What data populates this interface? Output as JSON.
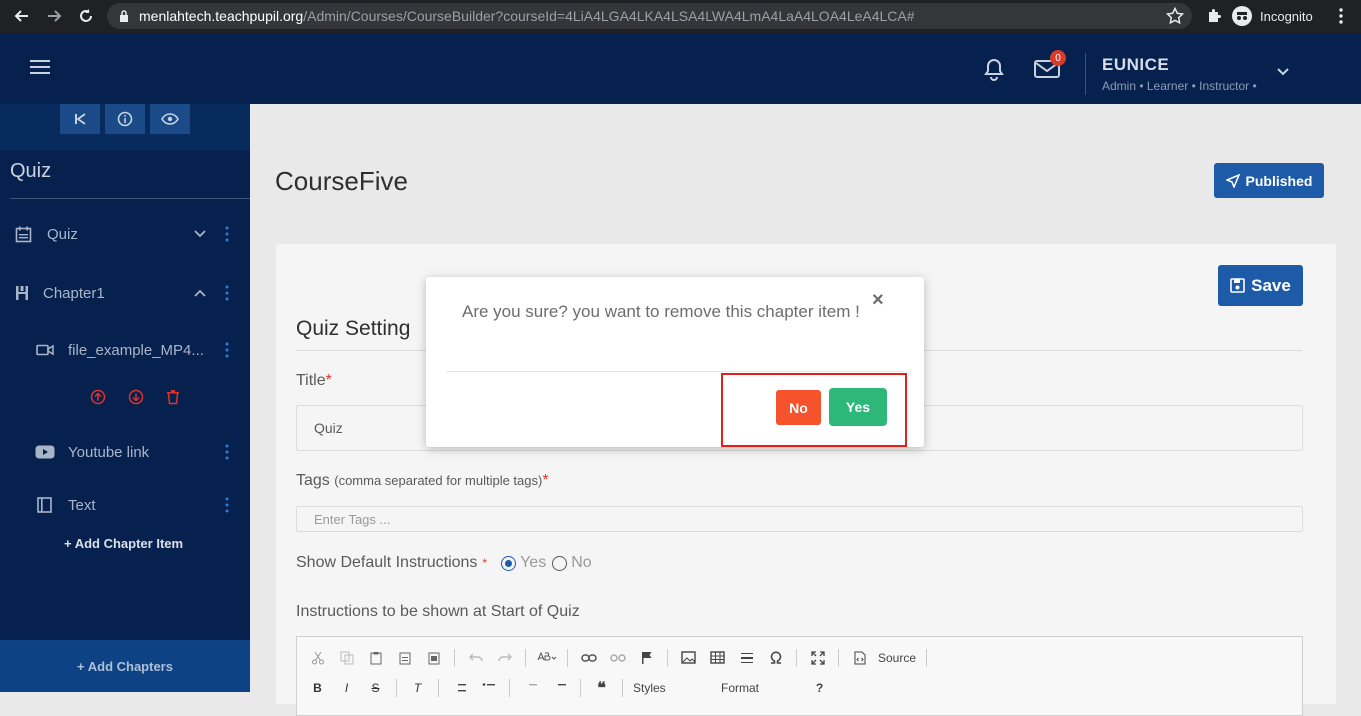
{
  "browser": {
    "url_host": "menlahtech.teachpupil.org",
    "url_path": "/Admin/Courses/CourseBuilder?courseId=4LiA4LGA4LKA4LSA4LWA4LmA4LaA4LOA4LeA4LCA#",
    "incognito_label": "Incognito"
  },
  "header": {
    "mail_badge": "0",
    "user_name": "EUNICE",
    "user_roles": "Admin • Learner • Instructor •"
  },
  "sidebar": {
    "title": "Quiz",
    "items": [
      {
        "label": "Quiz"
      },
      {
        "label": "Chapter1"
      },
      {
        "label": "file_example_MP4..."
      },
      {
        "label": "Youtube link"
      },
      {
        "label": "Text"
      }
    ],
    "add_item_label": "+ Add Chapter Item",
    "add_chapters_label": "+  Add Chapters"
  },
  "main": {
    "course_title": "CourseFive",
    "published_label": "Published",
    "save_label": "Save",
    "section_title": "Quiz Setting",
    "title_label": "Title",
    "title_value": "Quiz",
    "tags_label": "Tags",
    "tags_hint": "(comma separated for multiple tags)",
    "tags_placeholder": "Enter Tags ...",
    "instructions_label": "Show Default Instructions",
    "radio_yes": "Yes",
    "radio_no": "No",
    "start_instructions_label": "Instructions to be shown at Start of Quiz",
    "editor_source_label": "Source",
    "editor_styles_label": "Styles",
    "editor_format_label": "Format",
    "required_mark": "*"
  },
  "modal": {
    "message": "Are you sure? you want to remove this chapter item !",
    "close_glyph": "×",
    "no_label": "No",
    "yes_label": "Yes"
  },
  "colors": {
    "header_bg": "#06214d",
    "primary": "#1d5ba8",
    "no_button": "#f4532b",
    "yes_button": "#2db87a",
    "highlight": "#e0201b"
  }
}
